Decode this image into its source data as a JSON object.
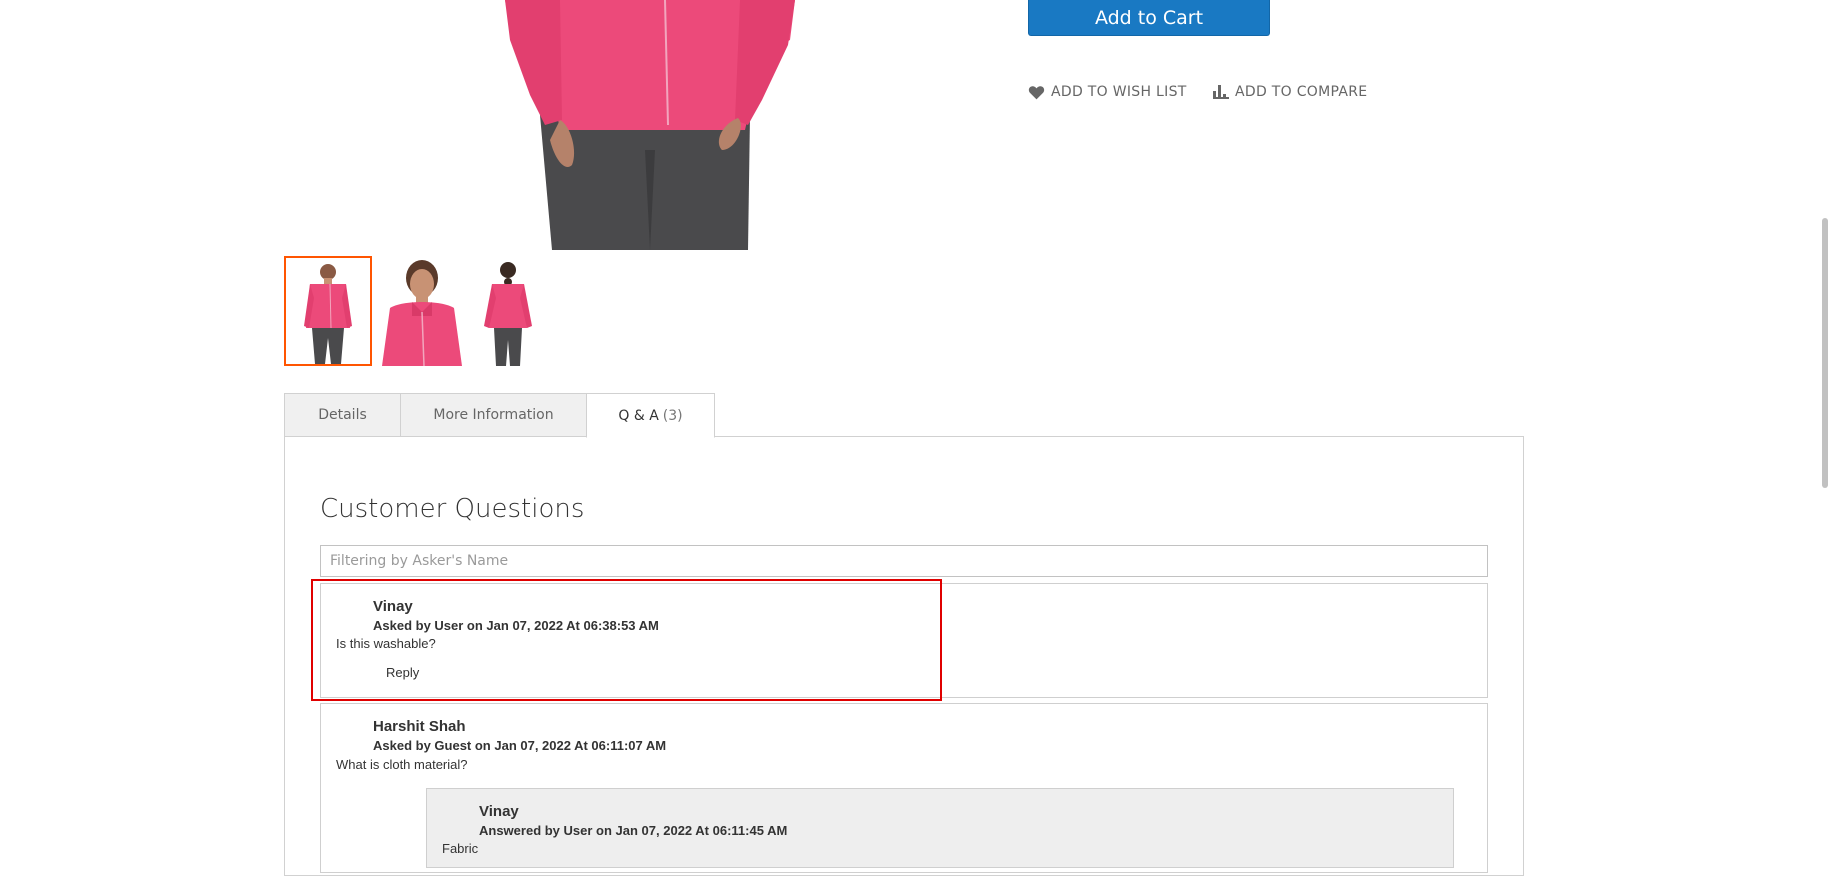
{
  "product": {
    "add_to_cart": "Add to Cart",
    "wish_list": "ADD TO WISH LIST",
    "compare": "ADD TO COMPARE",
    "accent_color": "#1979c3",
    "product_color": "#ec4a7a"
  },
  "tabs": [
    {
      "label": "Details"
    },
    {
      "label": "More Information"
    },
    {
      "label": "Q & A",
      "count": "(3)"
    }
  ],
  "questions_section": {
    "title": "Customer Questions",
    "filter_placeholder": "Filtering by Asker's Name",
    "filter_value": ""
  },
  "questions": [
    {
      "name": "Vinay",
      "meta": "Asked by User on Jan 07, 2022 At 06:38:53 AM",
      "text": "Is this washable?",
      "reply_label": "Reply"
    },
    {
      "name": "Harshit Shah",
      "meta": "Asked by Guest on Jan 07, 2022 At 06:11:07 AM",
      "text": "What is cloth material?",
      "answers": [
        {
          "name": "Vinay",
          "meta": "Answered by User on Jan 07, 2022 At 06:11:45 AM",
          "text": "Fabric"
        }
      ]
    }
  ]
}
